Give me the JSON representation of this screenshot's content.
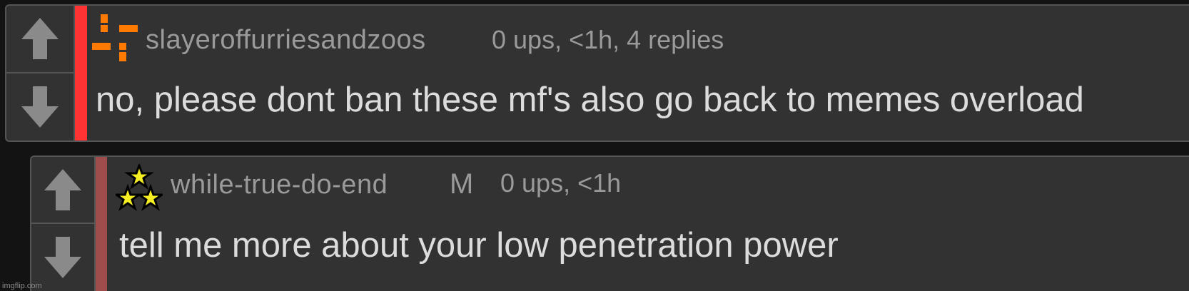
{
  "comments": [
    {
      "username": "slayeroffurriesandzoos",
      "meta": "0 ups, <1h, 4 replies",
      "text": "no, please dont ban these mf's also go back to memes overload",
      "bar_color": "#ff3333",
      "avatar_icon": "orange-blocks-icon"
    },
    {
      "username": "while-true-do-end",
      "badge": "M",
      "meta": "0 ups, <1h",
      "text": "tell me more about your low penetration power",
      "bar_color": "#9e4c4c",
      "avatar_icon": "three-stars-icon"
    }
  ],
  "watermark": "imgflip.com",
  "colors": {
    "background": "#131313",
    "panel": "#323232",
    "border": "#555555",
    "arrow": "#8a8a8a",
    "username": "#9a9a9a",
    "text": "#dcdcdc",
    "orange": "#ff7a00",
    "star": "#f6ee22"
  }
}
